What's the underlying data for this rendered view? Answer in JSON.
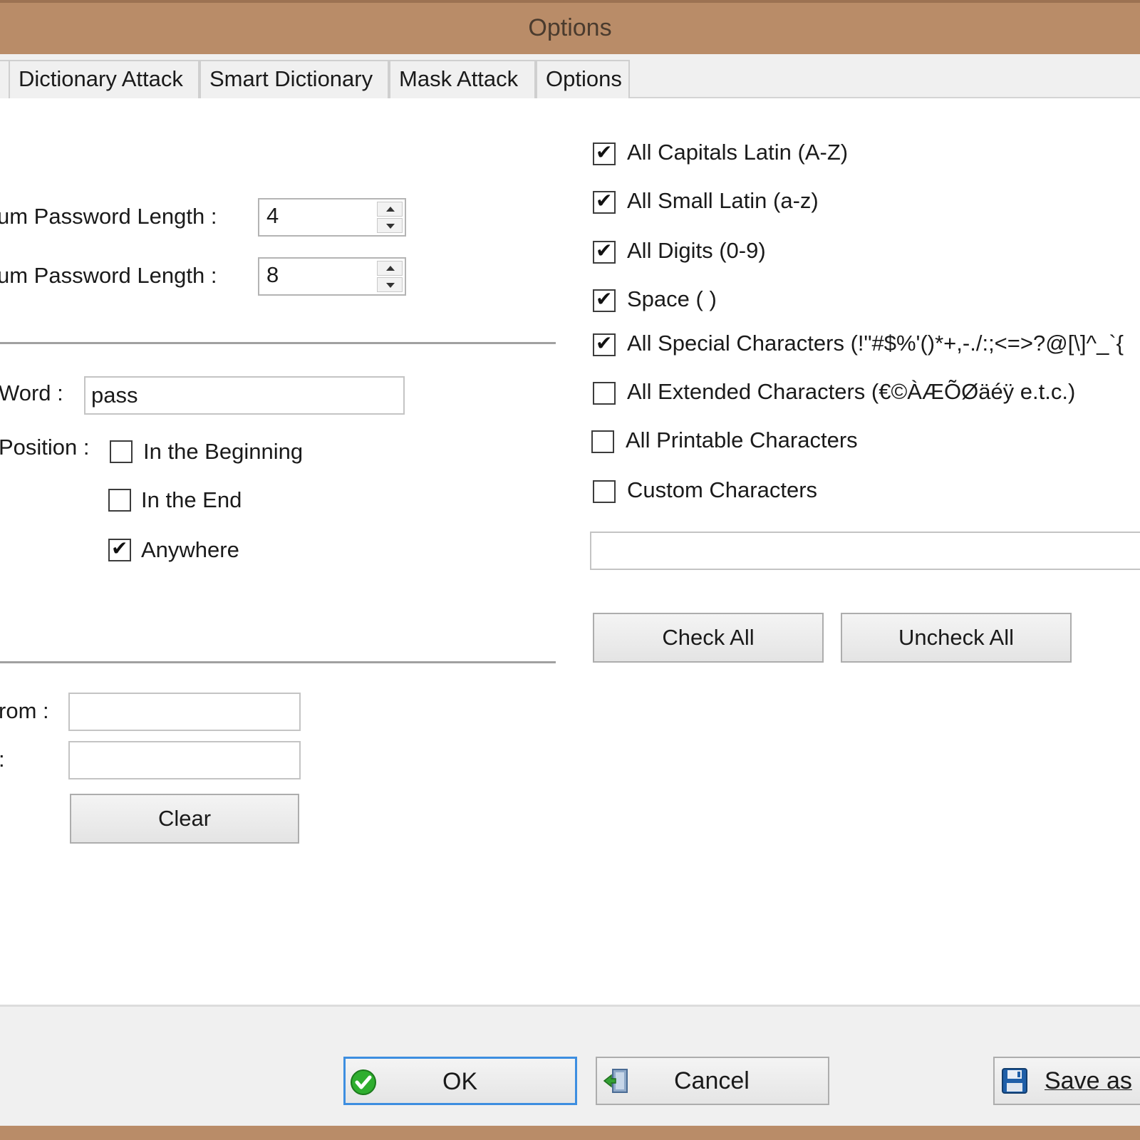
{
  "window": {
    "title": "Options",
    "frame_color": "#b98c68",
    "accent_focus": "#3d8ee0"
  },
  "tabs": [
    {
      "label": ""
    },
    {
      "label": "Dictionary Attack"
    },
    {
      "label": "Smart Dictionary"
    },
    {
      "label": "Mask Attack"
    },
    {
      "label": "Options"
    }
  ],
  "length": {
    "min_label": "um Password Length :",
    "min_value": "4",
    "max_label": "um Password Length :",
    "max_value": "8"
  },
  "word": {
    "label": "Word :",
    "value": "pass",
    "position_label": "Position :",
    "options": [
      {
        "label": "In the Beginning",
        "checked": false
      },
      {
        "label": "In the End",
        "checked": false
      },
      {
        "label": "Anywhere",
        "checked": true
      }
    ]
  },
  "range": {
    "from_label": "rom :",
    "to_label": ":",
    "from_value": "",
    "to_value": "",
    "clear_label": "Clear"
  },
  "charsets": [
    {
      "label": "All Capitals Latin (A-Z)",
      "checked": true
    },
    {
      "label": "All Small Latin (a-z)",
      "checked": true
    },
    {
      "label": "All Digits (0-9)",
      "checked": true
    },
    {
      "label": "Space ( )",
      "checked": true
    },
    {
      "label": "All Special Characters (!\"#$%'()*+,-./:;<=>?@[\\]^_`{",
      "checked": true
    },
    {
      "label": "All Extended Characters (€©ÀÆÕØäéÿ e.t.c.)",
      "checked": false
    },
    {
      "label": "All Printable Characters",
      "checked": false
    },
    {
      "label": "Custom Characters",
      "checked": false
    }
  ],
  "custom_chars_value": "",
  "buttons": {
    "check_all": "Check All",
    "uncheck_all": "Uncheck All",
    "ok": "OK",
    "cancel": "Cancel",
    "save_as": "Save as"
  },
  "icons": {
    "ok": "green-check-icon",
    "cancel": "exit-door-icon",
    "save": "floppy-disk-icon"
  }
}
